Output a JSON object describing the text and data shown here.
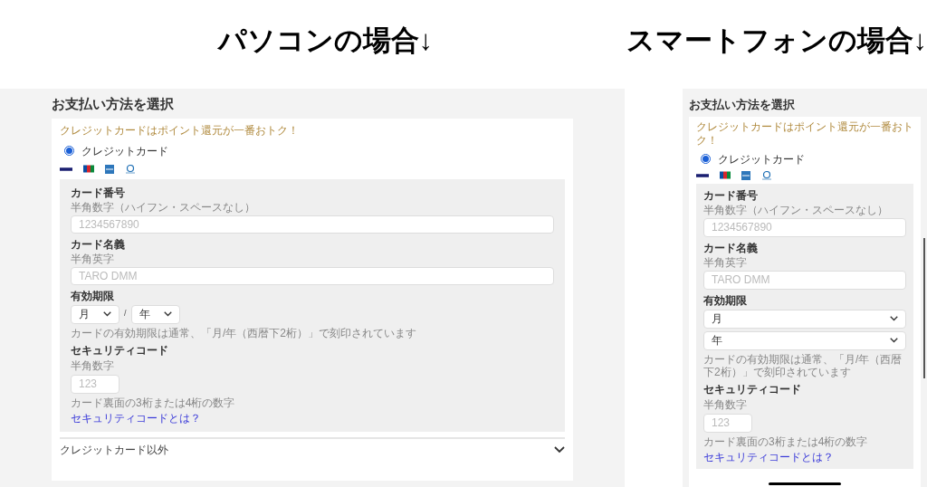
{
  "sections": [
    {
      "heading": "パソコンの場合↓",
      "kind": "desktop",
      "screen": {
        "title": "お支払い方法を選択",
        "promo": "クレジットカードはポイント還元が一番おトク！",
        "method": {
          "label": "クレジットカード",
          "selected": true
        },
        "card_number": {
          "label": "カード番号",
          "hint": "半角数字（ハイフン・スペースなし）",
          "placeholder": "1234567890"
        },
        "card_name": {
          "label": "カード名義",
          "hint": "半角英字",
          "placeholder": "TARO DMM"
        },
        "expiry": {
          "label": "有効期限",
          "month": "月",
          "separator": "/",
          "year": "年",
          "note": "カードの有効期限は通常、「月/年（西暦下2桁）」で刻印されています"
        },
        "security": {
          "label": "セキュリティコード",
          "hint": "半角数字",
          "placeholder": "123",
          "note": "カード裏面の3桁または4桁の数字",
          "link": "セキュリティコードとは？"
        },
        "other_methods": {
          "label": "クレジットカード以外",
          "expanded": false
        }
      }
    },
    {
      "heading": "スマートフォンの場合↓",
      "kind": "phone",
      "screen": {
        "title": "お支払い方法を選択",
        "promo": "クレジットカードはポイント還元が一番おトク！",
        "method": {
          "label": "クレジットカード",
          "selected": true
        },
        "card_number": {
          "label": "カード番号",
          "hint": "半角数字（ハイフン・スペースなし）",
          "placeholder": "1234567890"
        },
        "card_name": {
          "label": "カード名義",
          "hint": "半角英字",
          "placeholder": "TARO DMM"
        },
        "expiry": {
          "label": "有効期限",
          "month": "月",
          "year": "年",
          "note": "カードの有効期限は通常、「月/年（西暦下2桁）」で刻印されています"
        },
        "security": {
          "label": "セキュリティコード",
          "hint": "半角数字",
          "placeholder": "123",
          "note": "カード裏面の3桁または4桁の数字",
          "link": "セキュリティコードとは？"
        }
      }
    }
  ]
}
